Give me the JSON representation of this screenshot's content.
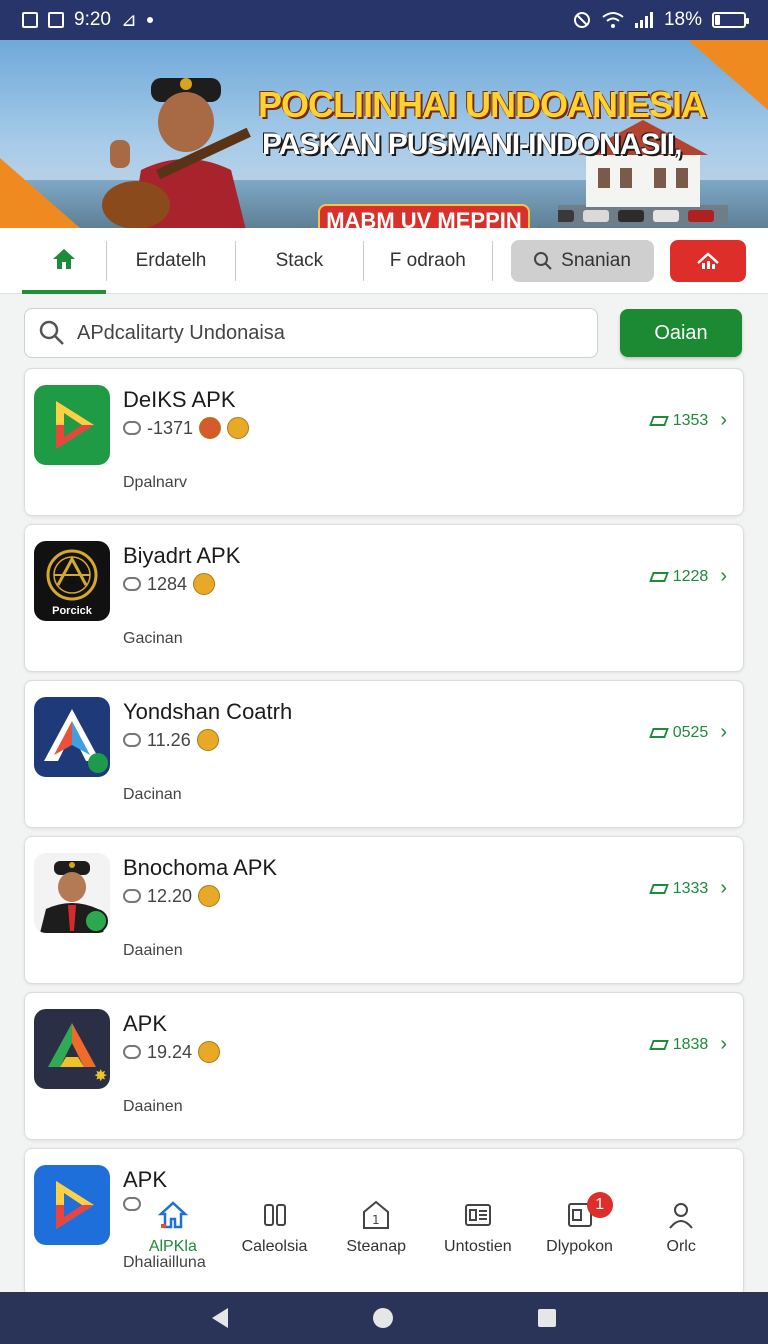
{
  "status_bar": {
    "time": "9:20",
    "battery_text": "18%",
    "battery_level": 0.18
  },
  "banner": {
    "title": "POCLIINHAI UNDOANIESIA",
    "subtitle": "PASKAN PUSMANI-INDONASII,",
    "cta": "MABM UV MEPPIN"
  },
  "tabs": [
    {
      "label": "",
      "icon": "home-icon"
    },
    {
      "label": "Erdatelh"
    },
    {
      "label": "Stack"
    },
    {
      "label": "F odraoh"
    },
    {
      "label": "Snanian",
      "icon": "search-icon"
    },
    {
      "label": "",
      "icon": "chart-icon"
    }
  ],
  "search": {
    "value": "APdcalitarty Undonaisa",
    "button_label": "Oaian"
  },
  "apps": [
    {
      "name": "DeIKS APK",
      "count": "-1371",
      "rating": "1353",
      "category": "Dpalnarv",
      "icon": "play-store-icon"
    },
    {
      "name": "Biyadrt APK",
      "count": "1284",
      "rating": "1228",
      "category": "Gacinan",
      "icon": "emblem-icon",
      "icon_caption": "Porcick"
    },
    {
      "name": "Yondshan Coatrh",
      "count": "11.26",
      "rating": "0525",
      "category": "Dacinan",
      "icon": "triangle-logo-icon"
    },
    {
      "name": "Bnochoma APK",
      "count": "12.20",
      "rating": "1333",
      "category": "Daainen",
      "icon": "officer-portrait-icon"
    },
    {
      "name": "APK",
      "count": "19.24",
      "rating": "1838",
      "category": "Daainen",
      "icon": "drive-logo-icon"
    },
    {
      "name": "APK",
      "count": "",
      "rating": "",
      "category": "Dhaliailluna",
      "icon": "play-logo-blue-icon"
    }
  ],
  "bottom_nav": [
    {
      "label": "AlPKla",
      "icon": "home-nav-icon",
      "active": true
    },
    {
      "label": "Caleolsia",
      "icon": "columns-icon"
    },
    {
      "label": "Steanap",
      "icon": "shield-one-icon"
    },
    {
      "label": "Untostien",
      "icon": "document-icon"
    },
    {
      "label": "Dlypokon",
      "icon": "inbox-icon",
      "badge": "1"
    },
    {
      "label": "Orlc",
      "icon": "profile-icon"
    }
  ],
  "colors": {
    "status_bar": "#27356b",
    "accent_green": "#1b8a32",
    "accent_red": "#dd2e2a",
    "android_nav": "#2a3358"
  }
}
